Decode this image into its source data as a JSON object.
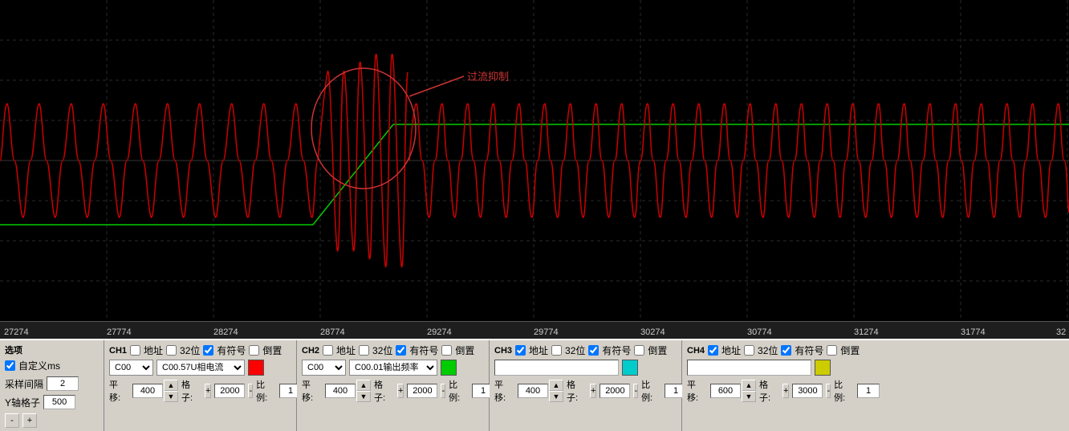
{
  "chart": {
    "background": "#000000",
    "grid_color": "#333333",
    "annotation_label": "过流抑制",
    "x_ticks": [
      "27274",
      "27774",
      "28274",
      "28774",
      "29274",
      "29774",
      "30274",
      "30774",
      "31274",
      "31774",
      "32"
    ]
  },
  "controls": {
    "left_panel": {
      "label": "选项",
      "custom_ms_label": "自定义ms",
      "sample_interval_label": "采样间隔",
      "sample_interval_value": "2",
      "y_axis_label": "Y轴格子",
      "y_axis_value": "500",
      "btn_minus": "-",
      "btn_plus": "+"
    },
    "ch1": {
      "title": "CH1",
      "addr_label": "地址",
      "bits32_label": "32位",
      "signed_label": "有符号",
      "invert_label": "倒置",
      "addr_checked": false,
      "bits32_checked": false,
      "signed_checked": true,
      "invert_checked": false,
      "dropdown1_value": "C00",
      "dropdown2_value": "C00.57U相电流",
      "color": "#ff0000",
      "offset_label": "平移:",
      "offset_value": "400",
      "grid_label": "格子:",
      "grid_value": "2000",
      "scale_label": "比例:",
      "scale_value": "1"
    },
    "ch2": {
      "title": "CH2",
      "addr_label": "地址",
      "bits32_label": "32位",
      "signed_label": "有符号",
      "invert_label": "倒置",
      "addr_checked": false,
      "bits32_checked": false,
      "signed_checked": true,
      "invert_checked": false,
      "dropdown1_value": "C00",
      "dropdown2_value": "C00.01输出频率",
      "color": "#00ff00",
      "offset_label": "平移:",
      "offset_value": "400",
      "grid_label": "格子:",
      "grid_value": "2000",
      "scale_label": "比例:",
      "scale_value": "1"
    },
    "ch3": {
      "title": "CH3",
      "addr_label": "地址",
      "bits32_label": "32位",
      "signed_label": "有符号",
      "invert_label": "倒置",
      "addr_checked": true,
      "bits32_checked": false,
      "signed_checked": true,
      "invert_checked": false,
      "dropdown1_value": "",
      "dropdown2_value": "",
      "color": "#00ffff",
      "offset_label": "平移:",
      "offset_value": "400",
      "grid_label": "格子:",
      "grid_value": "2000",
      "scale_label": "比例:",
      "scale_value": "1"
    },
    "ch4": {
      "title": "CH4",
      "addr_label": "地址",
      "bits32_label": "32位",
      "signed_label": "有符号",
      "invert_label": "倒置",
      "addr_checked": true,
      "bits32_checked": false,
      "signed_checked": true,
      "invert_checked": false,
      "dropdown1_value": "",
      "dropdown2_value": "",
      "color": "#ffff00",
      "offset_label": "平移:",
      "offset_value": "600",
      "grid_label": "格子:",
      "grid_value": "3000",
      "scale_label": "比例:",
      "scale_value": "1"
    }
  }
}
